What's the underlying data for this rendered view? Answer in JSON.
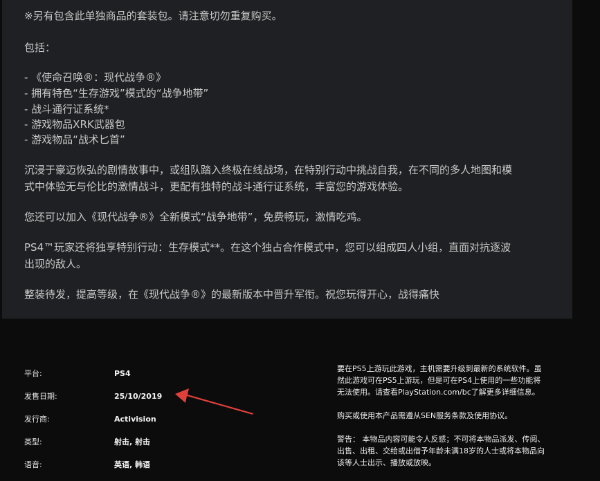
{
  "description": {
    "bundle_note": "※另有包含此单独商品的套装包。请注意切勿重复购买。",
    "includes_heading": "包括：",
    "includes": [
      "- 《使命召唤®：现代战争®》",
      "- 拥有特色“生存游戏”模式的“战争地带”",
      "- 战斗通行证系统*",
      "- 游戏物品XRK武器包",
      "- 游戏物品“战术匕首”"
    ],
    "paragraph1_line1": "沉浸于豪迈恢弘的剧情故事中，或组队踏入终极在线战场，在特别行动中挑战自我，在不同的多人地图和模",
    "paragraph1_line2": "式中体验无与伦比的激情战斗，更配有独特的战斗通行证系统，丰富您的游戏体验。",
    "paragraph2": "您还可以加入《现代战争®》全新模式“战争地带”，免费畅玩，激情吃鸡。",
    "paragraph3_line1": "PS4™玩家还将独享特别行动：生存模式**。在这个独占合作模式中，您可以组成四人小组，直面对抗逐波",
    "paragraph3_line2": "出现的敌人。",
    "paragraph4": "整装待发，提高等级，在《现代战争®》的最新版本中晋升军衔。祝您玩得开心，战得痛快"
  },
  "info": {
    "platform_label": "平台:",
    "platform_value": "PS4",
    "release_label": "发售日期:",
    "release_value": "25/10/2019",
    "publisher_label": "发行商:",
    "publisher_value": "Activision",
    "genre_label": "类型:",
    "genre_value": "射击, 射击",
    "language_label": "语音:",
    "language_value": "英语, 韩语"
  },
  "notes": {
    "ps5_line1": "要在PS5上游玩此游戏，主机需要升级到最新的系统软件。虽",
    "ps5_line2": "然此游戏可在PS5上游玩，但是可在PS4上使用的一些功能将",
    "ps5_line3": "无法使用。请查看PlayStation.com/bc了解更多详细信息。",
    "terms": "购买或使用本产品需遵从SEN服务条款及使用协议。",
    "warning_line1": "警告：  本物品内容可能令人反感；不可将本物品派发、传阅、",
    "warning_line2": "出售、出租、交给或出借予年龄未满18岁的人士或将本物品向",
    "warning_line3": "该等人士出示、播放或放映。"
  },
  "colors": {
    "page_background": "#0c0c0c",
    "panel_background": "#1f2023",
    "annotation_arrow": "#e0403a"
  }
}
